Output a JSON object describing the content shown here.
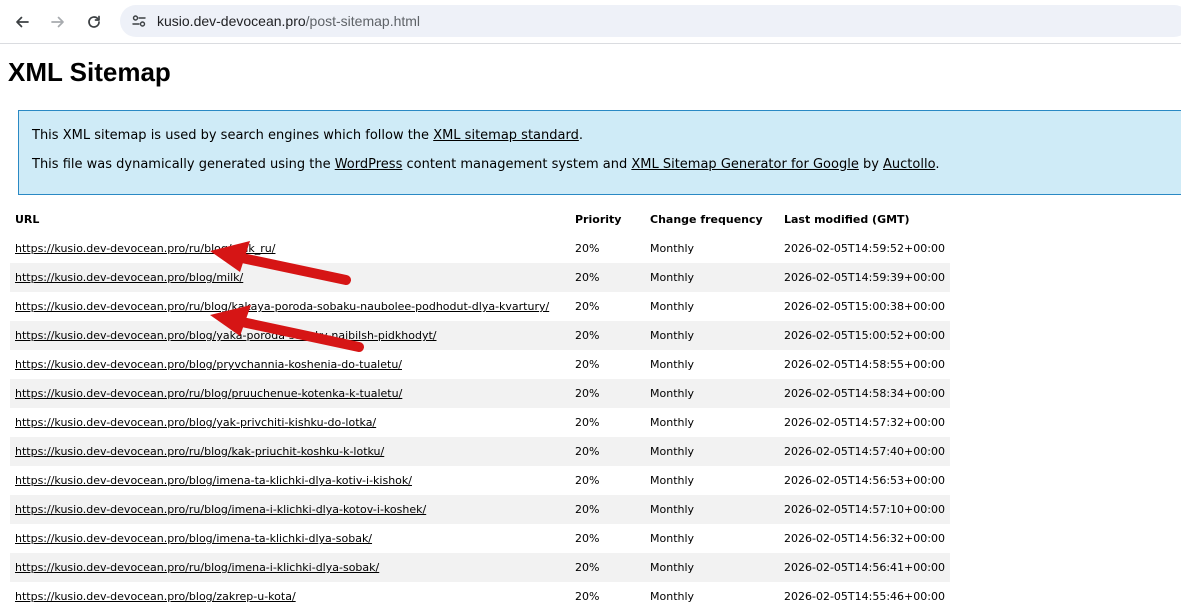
{
  "browser": {
    "url_host": "kusio.dev-devocean.pro",
    "url_path": "/post-sitemap.html"
  },
  "page": {
    "title": "XML Sitemap",
    "info_line1": {
      "text_before": "This XML sitemap is used by search engines which follow the ",
      "link": "XML sitemap standard",
      "text_after": "."
    },
    "info_line2": {
      "text1": "This file was dynamically generated using the ",
      "link1": "WordPress",
      "text2": " content management system and ",
      "link2": "XML Sitemap Generator for Google",
      "text3": " by ",
      "link3": "Auctollo",
      "text4": "."
    }
  },
  "table": {
    "headers": {
      "url": "URL",
      "priority": "Priority",
      "change_frequency": "Change frequency",
      "last_modified": "Last modified (GMT)"
    },
    "rows": [
      {
        "url": "https://kusio.dev-devocean.pro/ru/blog/milk_ru/",
        "priority": "20%",
        "freq": "Monthly",
        "modified": "2026-02-05T14:59:52+00:00"
      },
      {
        "url": "https://kusio.dev-devocean.pro/blog/milk/",
        "priority": "20%",
        "freq": "Monthly",
        "modified": "2026-02-05T14:59:39+00:00"
      },
      {
        "url": "https://kusio.dev-devocean.pro/ru/blog/kakaya-poroda-sobaku-naubolee-podhodut-dlya-kvartury/",
        "priority": "20%",
        "freq": "Monthly",
        "modified": "2026-02-05T15:00:38+00:00"
      },
      {
        "url": "https://kusio.dev-devocean.pro/blog/yaka-poroda-sobaky-naibilsh-pidkhodyt/",
        "priority": "20%",
        "freq": "Monthly",
        "modified": "2026-02-05T15:00:52+00:00"
      },
      {
        "url": "https://kusio.dev-devocean.pro/blog/pryvchannia-koshenia-do-tualetu/",
        "priority": "20%",
        "freq": "Monthly",
        "modified": "2026-02-05T14:58:55+00:00"
      },
      {
        "url": "https://kusio.dev-devocean.pro/ru/blog/pruuchenue-kotenka-k-tualetu/",
        "priority": "20%",
        "freq": "Monthly",
        "modified": "2026-02-05T14:58:34+00:00"
      },
      {
        "url": "https://kusio.dev-devocean.pro/blog/yak-privchiti-kishku-do-lotka/",
        "priority": "20%",
        "freq": "Monthly",
        "modified": "2026-02-05T14:57:32+00:00"
      },
      {
        "url": "https://kusio.dev-devocean.pro/ru/blog/kak-priuchit-koshku-k-lotku/",
        "priority": "20%",
        "freq": "Monthly",
        "modified": "2026-02-05T14:57:40+00:00"
      },
      {
        "url": "https://kusio.dev-devocean.pro/blog/imena-ta-klichki-dlya-kotiv-i-kishok/",
        "priority": "20%",
        "freq": "Monthly",
        "modified": "2026-02-05T14:56:53+00:00"
      },
      {
        "url": "https://kusio.dev-devocean.pro/ru/blog/imena-i-klichki-dlya-kotov-i-koshek/",
        "priority": "20%",
        "freq": "Monthly",
        "modified": "2026-02-05T14:57:10+00:00"
      },
      {
        "url": "https://kusio.dev-devocean.pro/blog/imena-ta-klichki-dlya-sobak/",
        "priority": "20%",
        "freq": "Monthly",
        "modified": "2026-02-05T14:56:32+00:00"
      },
      {
        "url": "https://kusio.dev-devocean.pro/ru/blog/imena-i-klichki-dlya-sobak/",
        "priority": "20%",
        "freq": "Monthly",
        "modified": "2026-02-05T14:56:41+00:00"
      },
      {
        "url": "https://kusio.dev-devocean.pro/blog/zakrep-u-kota/",
        "priority": "20%",
        "freq": "Monthly",
        "modified": "2026-02-05T14:55:46+00:00"
      }
    ]
  },
  "annotation": {
    "arrow_color": "#d61515"
  },
  "icons": {
    "back": "back-arrow-icon",
    "forward": "forward-arrow-icon",
    "reload": "reload-icon",
    "site_info": "site-info-tune-icon"
  }
}
